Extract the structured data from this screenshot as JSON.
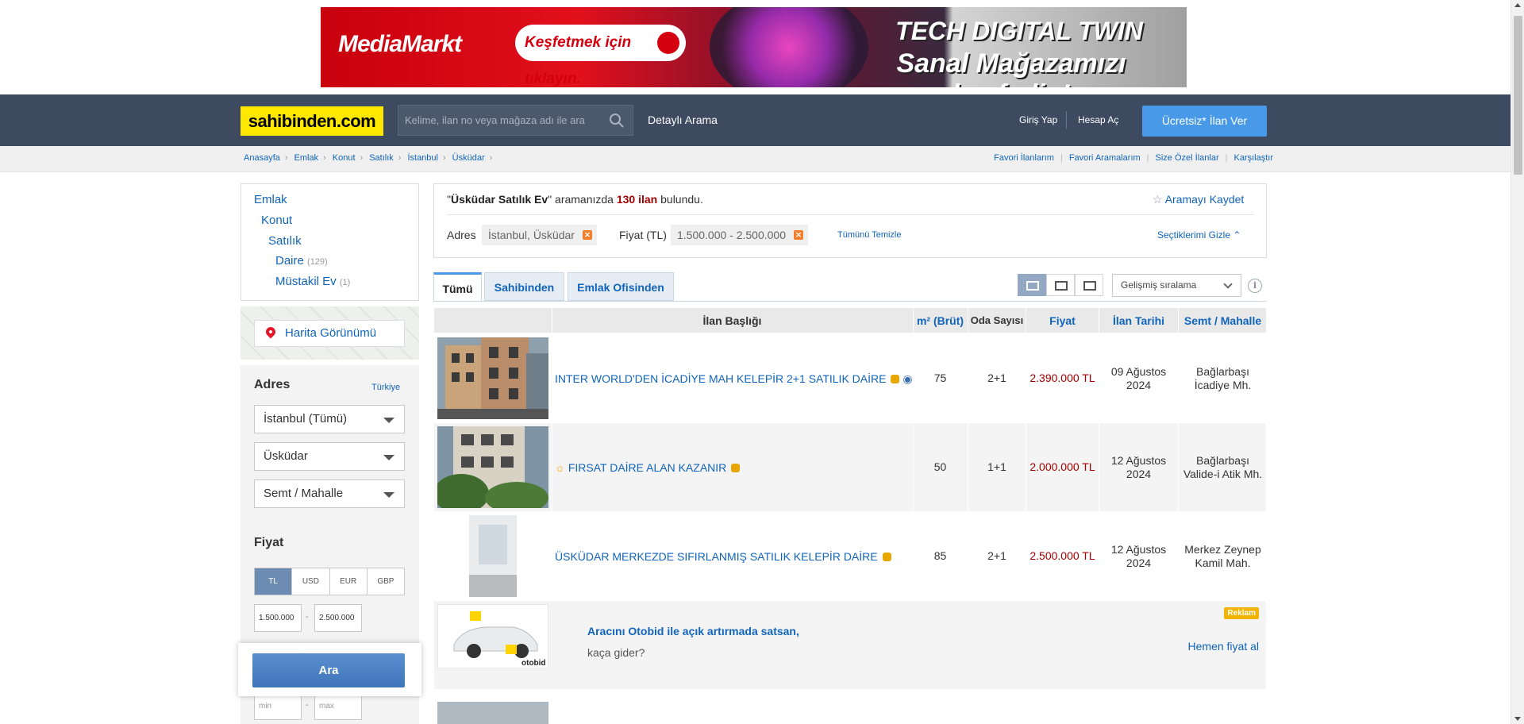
{
  "banner": {
    "brand": "MediaMarkt",
    "cta": "Keşfetmek için tıklayın.",
    "headline1": "TECH DIGITAL TWIN",
    "headline2": "Sanal Mağazamızı keşfedin!"
  },
  "header": {
    "logo": "sahibinden.com",
    "search_placeholder": "Kelime, ilan no veya mağaza adı ile ara",
    "detailed_search": "Detaylı Arama",
    "login": "Giriş Yap",
    "signup": "Hesap Aç",
    "post_ad": "Ücretsiz* İlan Ver"
  },
  "breadcrumb": [
    "Anasayfa",
    "Emlak",
    "Konut",
    "Satılık",
    "İstanbul",
    "Üsküdar"
  ],
  "top_links": [
    "Favori İlanlarım",
    "Favori Aramalarım",
    "Size Özel İlanlar",
    "Karşılaştır"
  ],
  "categories": {
    "emlak": "Emlak",
    "konut": "Konut",
    "satilik": "Satılık",
    "daire": "Daire",
    "daire_count": "(129)",
    "mustakil": "Müstakil Ev",
    "mustakil_count": "(1)"
  },
  "map_button": "Harita Görünümü",
  "filters": {
    "address_title": "Adres",
    "address_link": "Türkiye",
    "city": "İstanbul (Tümü)",
    "district": "Üsküdar",
    "neighborhood": "Semt / Mahalle",
    "price_title": "Fiyat",
    "currencies": [
      "TL",
      "USD",
      "EUR",
      "GBP"
    ],
    "active_currency": "TL",
    "price_min": "1.500.000",
    "price_max": "2.500.000",
    "dash": "-",
    "min_placeholder": "min",
    "max_placeholder": "max",
    "search_button": "Ara"
  },
  "summary": {
    "query": "Üsküdar Satılık Ev",
    "text_mid": " aramanızda ",
    "count": "130 ilan",
    "text_end": " bulundu.",
    "save_search": "Aramayı Kaydet",
    "address_label": "Adres",
    "address_value": "İstanbul, Üsküdar",
    "price_label": "Fiyat (TL)",
    "price_value": "1.500.000 - 2.500.000",
    "clear_all": "Tümünü Temizle",
    "hide_selected": "Seçtiklerimi Gizle"
  },
  "tabs": [
    "Tümü",
    "Sahibinden",
    "Emlak Ofisinden"
  ],
  "sort": "Gelişmiş sıralama",
  "columns": [
    "İlan Başlığı",
    "m² (Brüt)",
    "Oda Sayısı",
    "Fiyat",
    "İlan Tarihi",
    "Semt / Mahalle"
  ],
  "listings": [
    {
      "title": "INTER WORLD'DEN İCADİYE MAH KELEPİR 2+1 SATILIK DAİRE",
      "m2": "75",
      "rooms": "2+1",
      "price": "2.390.000 TL",
      "date": "09 Ağustos 2024",
      "location": "Bağlarbaşı İcadiye Mh."
    },
    {
      "title": "FIRSAT DAİRE ALAN KAZANIR",
      "m2": "50",
      "rooms": "1+1",
      "price": "2.000.000 TL",
      "date": "12 Ağustos 2024",
      "location": "Bağlarbaşı Valide-i Atik Mh."
    },
    {
      "title": "ÜSKÜDAR MERKEZDE SIFIRLANMIŞ SATILIK KELEPİR DAİRE",
      "m2": "85",
      "rooms": "2+1",
      "price": "2.500.000 TL",
      "date": "12 Ağustos 2024",
      "location": "Merkez Zeynep Kamil Mah."
    }
  ],
  "ad": {
    "line1": "Aracını Otobid ile açık artırmada satsan,",
    "line2": "kaça gider?",
    "badge": "Reklam",
    "cta": "Hemen fiyat al",
    "logo": "otobid"
  },
  "colors": {
    "header_bg": "#3e4a5f",
    "logo_bg": "#ffe800",
    "link": "#1064bc",
    "price": "#a10000",
    "cta": "#489ae9"
  }
}
